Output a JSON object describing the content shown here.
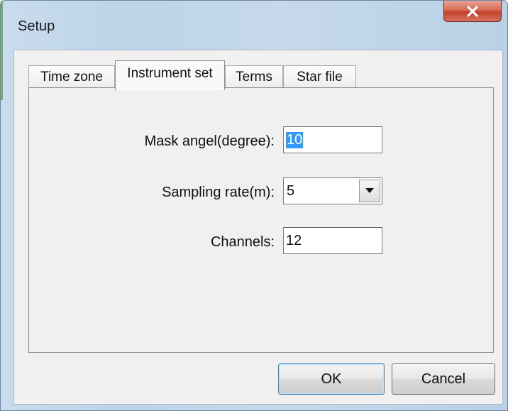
{
  "window": {
    "title": "Setup",
    "close_icon": "close-x-icon"
  },
  "tabs": [
    {
      "label": "Time zone",
      "active": false
    },
    {
      "label": "Instrument set",
      "active": true
    },
    {
      "label": "Terms",
      "active": false
    },
    {
      "label": "Star file",
      "active": false
    }
  ],
  "form": {
    "mask_angle": {
      "label": "Mask angel(degree):",
      "value": "10",
      "selected": true
    },
    "sampling_rate": {
      "label": "Sampling rate(m):",
      "value": "5",
      "dropdown_icon": "chevron-down-icon"
    },
    "channels": {
      "label": "Channels:",
      "value": "12"
    }
  },
  "buttons": {
    "ok": "OK",
    "cancel": "Cancel"
  },
  "colors": {
    "selection": "#3399ff",
    "close_button": "#c4402b",
    "title_bar": "#c6d9eb",
    "dialog_face": "#f0f0f0"
  }
}
